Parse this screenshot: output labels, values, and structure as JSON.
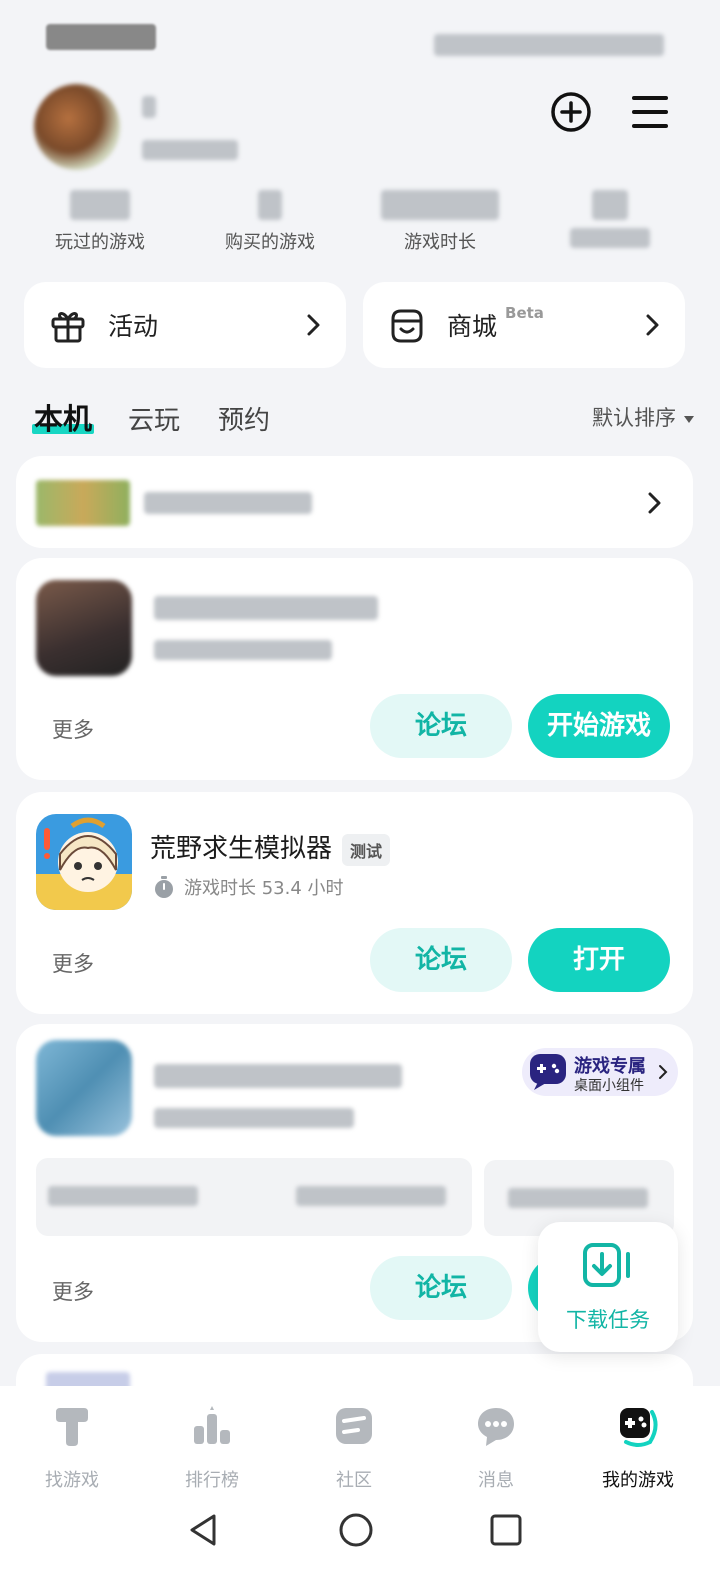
{
  "stats": [
    {
      "label": "玩过的游戏"
    },
    {
      "label": "购买的游戏"
    },
    {
      "label": "游戏时长"
    },
    {
      "label": ""
    }
  ],
  "quick": {
    "activity_label": "活动",
    "mall_label": "商城",
    "mall_badge": "Beta"
  },
  "tabs": {
    "local": "本机",
    "cloud": "云玩",
    "reserve": "预约",
    "sort": "默认排序"
  },
  "games": [
    {
      "more": "更多",
      "forum": "论坛",
      "action": "开始游戏"
    },
    {
      "title": "荒野求生模拟器",
      "tag": "测试",
      "playtime": "游戏时长 53.4 小时",
      "more": "更多",
      "forum": "论坛",
      "action": "打开"
    },
    {
      "more": "更多",
      "forum": "论坛",
      "widget_title": "游戏专属",
      "widget_sub": "桌面小组件"
    }
  ],
  "download": {
    "label": "下载任务"
  },
  "nav": [
    {
      "label": "找游戏",
      "icon": "find-game-icon"
    },
    {
      "label": "排行榜",
      "icon": "ranking-icon"
    },
    {
      "label": "社区",
      "icon": "community-icon"
    },
    {
      "label": "消息",
      "icon": "message-icon"
    },
    {
      "label": "我的游戏",
      "icon": "my-games-icon"
    }
  ],
  "colors": {
    "accent": "#13d3c0",
    "accent_light": "#e3f8f6",
    "widget_bg": "#eeecfb"
  }
}
